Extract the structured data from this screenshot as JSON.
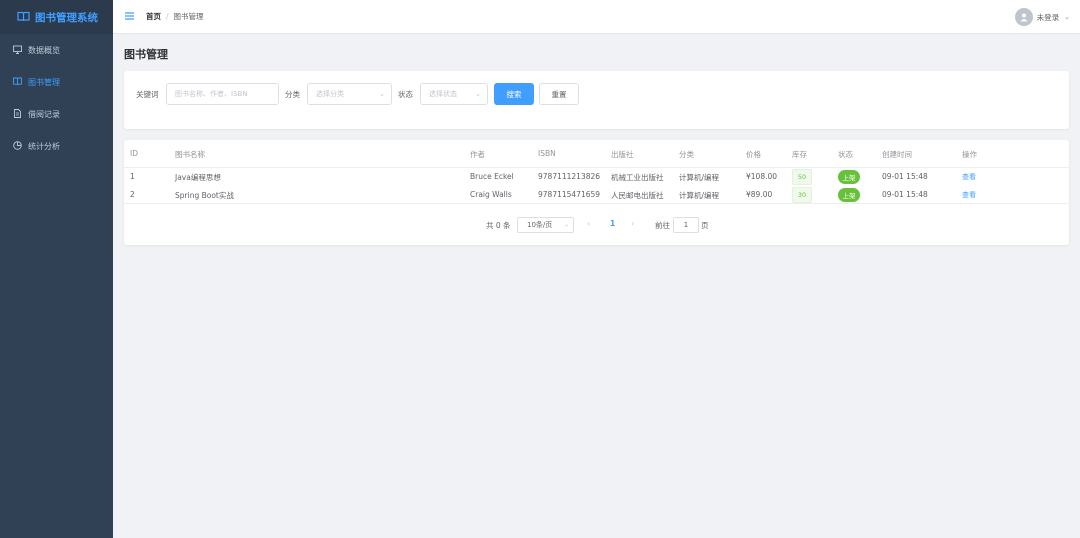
{
  "app": {
    "title": "图书管理系统"
  },
  "sidebar": {
    "items": [
      {
        "label": "数据概览",
        "icon": "monitor-icon",
        "active": false
      },
      {
        "label": "图书管理",
        "icon": "book-icon",
        "active": true
      },
      {
        "label": "借阅记录",
        "icon": "document-icon",
        "active": false
      },
      {
        "label": "统计分析",
        "icon": "pie-chart-icon",
        "active": false
      }
    ]
  },
  "header": {
    "breadcrumb": {
      "home": "首页",
      "separator": "/",
      "current": "图书管理"
    },
    "user_label": "未登录"
  },
  "main": {
    "page_title": "图书管理",
    "filter": {
      "keyword_label": "关键词",
      "keyword_placeholder": "图书名称、作者、ISBN",
      "category_label": "分类",
      "category_placeholder": "选择分类",
      "status_label": "状态",
      "status_placeholder": "选择状态",
      "search_button": "搜索",
      "reset_button": "重置"
    },
    "table": {
      "columns": [
        "ID",
        "图书名称",
        "作者",
        "ISBN",
        "出版社",
        "分类",
        "价格",
        "库存",
        "状态",
        "创建时间",
        "操作"
      ],
      "rows": [
        {
          "id": "1",
          "name": "Java编程思想",
          "author": "Bruce Eckel",
          "isbn": "9787111213826",
          "publisher": "机械工业出版社",
          "category": "计算机/编程",
          "price": "¥108.00",
          "stock": "50",
          "status": "上架",
          "created": "09-01 15:48",
          "action": "查看"
        },
        {
          "id": "2",
          "name": "Spring Boot实战",
          "author": "Craig Walls",
          "isbn": "9787115471659",
          "publisher": "人民邮电出版社",
          "category": "计算机/编程",
          "price": "¥89.00",
          "stock": "30",
          "status": "上架",
          "created": "09-01 15:48",
          "action": "查看"
        }
      ]
    },
    "pagination": {
      "total": "共 0 条",
      "page_size": "10条/页",
      "prev": "‹",
      "current": "1",
      "next": "›",
      "goto_label": "前往",
      "goto_value": "1",
      "page_suffix": "页"
    }
  },
  "colors": {
    "sidebar_bg": "#304156",
    "primary": "#409eff",
    "success": "#67c23a",
    "page_bg": "#f0f2f5"
  }
}
